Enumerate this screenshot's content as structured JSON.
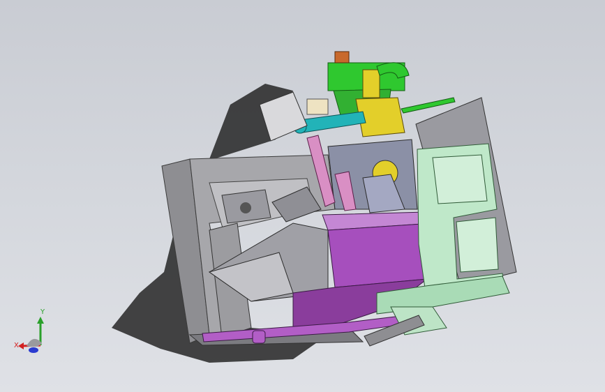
{
  "viewport": {
    "background_top": "#c9ccd3",
    "background_bottom": "#dfe1e6"
  },
  "model": {
    "colors": {
      "sheet_metal": "#8c8c8f",
      "purple_housing": "#a64fbd",
      "light_green_frame": "#b9e6c4",
      "bright_green": "#2fc82f",
      "yellow": "#e3cf2a",
      "orange": "#c8692c",
      "teal": "#22b3b8",
      "pink": "#d98fc4",
      "shadow": "#262626"
    }
  },
  "triad": {
    "x_label": "X",
    "y_label": "Y",
    "x_color": "#d22020",
    "y_color": "#2aa02a",
    "z_color": "#2a3bd0"
  }
}
